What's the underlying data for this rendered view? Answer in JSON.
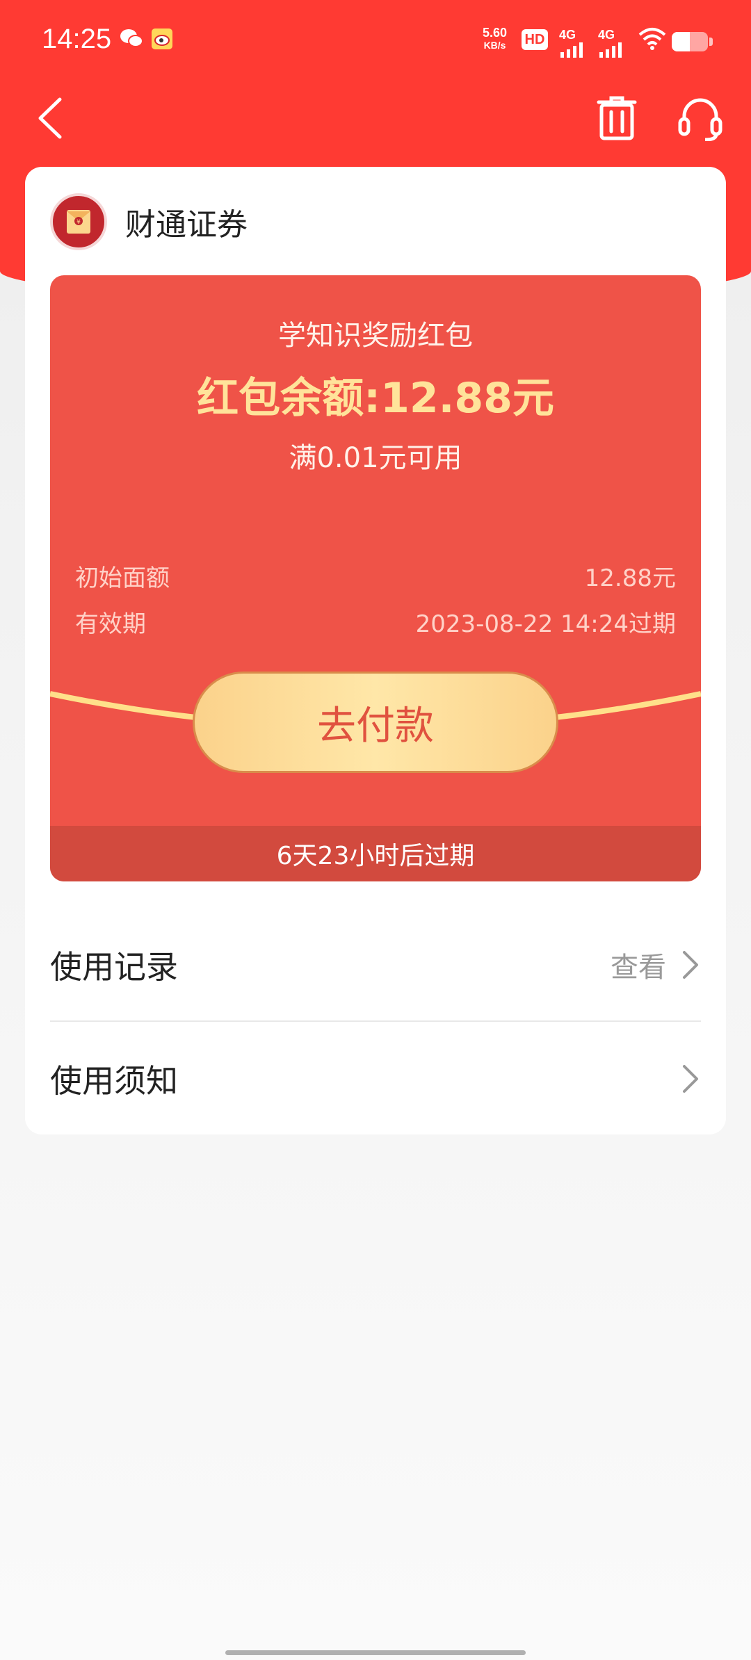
{
  "status_bar": {
    "time": "14:25",
    "net_speed_value": "5.60",
    "net_speed_unit": "KB/s",
    "hd_label": "HD",
    "signal1_label": "4G",
    "signal2_label": "4G",
    "icons": [
      "wechat-icon",
      "weibo-icon",
      "wifi-icon",
      "battery-icon"
    ]
  },
  "nav": {
    "back": "back-icon",
    "delete": "trash-icon",
    "service": "headset-icon"
  },
  "brand": {
    "name": "财通证券"
  },
  "coupon": {
    "title": "学知识奖励红包",
    "balance": "红包余额:12.88元",
    "condition": "满0.01元可用",
    "initial_label": "初始面额",
    "initial_value": "12.88元",
    "validity_label": "有效期",
    "validity_value": "2023-08-22 14:24过期",
    "pay_button": "去付款",
    "countdown": "6天23小时后过期"
  },
  "list": {
    "usage_record_label": "使用记录",
    "usage_record_action": "查看",
    "usage_notice_label": "使用须知"
  },
  "colors": {
    "header_red": "#ff3a33",
    "coupon_red": "#ef5348",
    "gold_text": "#ffe39a"
  }
}
